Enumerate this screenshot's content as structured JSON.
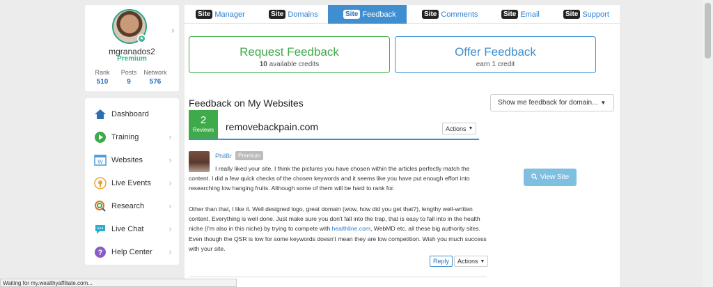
{
  "profile": {
    "username": "mgranados2",
    "membership": "Premium",
    "stats": [
      {
        "label": "Rank",
        "value": "510"
      },
      {
        "label": "Posts",
        "value": "9"
      },
      {
        "label": "Network",
        "value": "576"
      }
    ]
  },
  "nav": {
    "items": [
      {
        "label": "Dashboard",
        "icon": "home-icon"
      },
      {
        "label": "Training",
        "icon": "play-icon"
      },
      {
        "label": "Websites",
        "icon": "website-icon"
      },
      {
        "label": "Live Events",
        "icon": "live-events-icon"
      },
      {
        "label": "Research",
        "icon": "research-icon"
      },
      {
        "label": "Live Chat",
        "icon": "chat-icon"
      },
      {
        "label": "Help Center",
        "icon": "help-icon"
      }
    ]
  },
  "tabs": [
    {
      "pill": "Site",
      "label": "Manager",
      "active": false
    },
    {
      "pill": "Site",
      "label": "Domains",
      "active": false
    },
    {
      "pill": "Site",
      "label": "Feedback",
      "active": true
    },
    {
      "pill": "Site",
      "label": "Comments",
      "active": false
    },
    {
      "pill": "Site",
      "label": "Email",
      "active": false
    },
    {
      "pill": "Site",
      "label": "Support",
      "active": false
    }
  ],
  "request_feedback": {
    "title": "Request Feedback",
    "credits_count": "10",
    "credits_text": " available credits"
  },
  "offer_feedback": {
    "title": "Offer Feedback",
    "subtitle": "earn 1 credit"
  },
  "section_title": "Feedback on My Websites",
  "domain_filter": "Show me feedback for domain...",
  "website": {
    "reviews_count": "2",
    "reviews_label": "Reviews",
    "domain": "removebackpain.com",
    "actions_label": "Actions"
  },
  "comment": {
    "author": "PhilBr",
    "badge": "Premium",
    "paragraph1": "I really liked your site. I think the pictures you have chosen within the articles perfectly match the content. I did a few quick checks of the chosen keywords and it seems like you have put enough effort into researching low hanging fruits. Although some of them will be hard to rank for.",
    "paragraph2_before": "Other than that, I like it. Well designed logo, great domain (wow, how did you get that?), lengthy well-written content. Everything is well done. Just make sure you don't fall into the trap, that is easy to fall into in the health niche (I'm also in this niche) by trying to compete with ",
    "paragraph2_link": "healthline.com",
    "paragraph2_after": ", WebMD etc. all these big authority sites. Even though the QSR is low for some keywords doesn't mean they are low competition. Wish you much success with your site.",
    "reply_label": "Reply",
    "actions_label": "Actions"
  },
  "view_site_label": "View Site",
  "status_text": "Waiting for my.wealthyaffiliate.com...",
  "colors": {
    "accent": "#3e8ed0",
    "green": "#3faa4a",
    "premium": "#3fb38f"
  }
}
